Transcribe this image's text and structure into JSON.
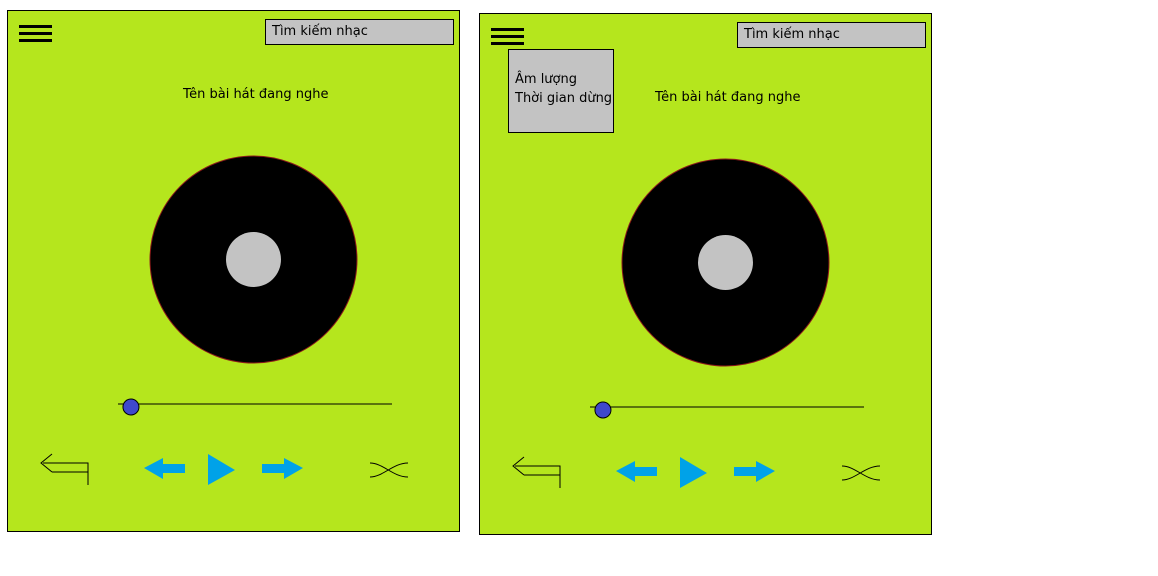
{
  "screens": [
    {
      "search": {
        "placeholder": "Tìm kiếm nhạc"
      },
      "song_title": "Tên bài hát đang nghe",
      "menu_open": false
    },
    {
      "search": {
        "placeholder": "Tìm kiếm nhạc"
      },
      "song_title": "Tên bài hát đang nghe",
      "menu_open": true,
      "menu_items": [
        "Âm lượng",
        "Thời gian dừng"
      ]
    }
  ],
  "colors": {
    "background": "#b5e61d",
    "control_blue": "#00a2e8",
    "slider_knob": "#3f48cc",
    "disc": "#000000",
    "disc_center": "#c3c3c3"
  },
  "icons": {
    "menu": "hamburger-icon",
    "back": "return-arrow-icon",
    "previous": "arrow-left-icon",
    "play": "play-icon",
    "next": "arrow-right-icon",
    "shuffle": "shuffle-icon"
  },
  "playback": {
    "progress": 0.04
  }
}
